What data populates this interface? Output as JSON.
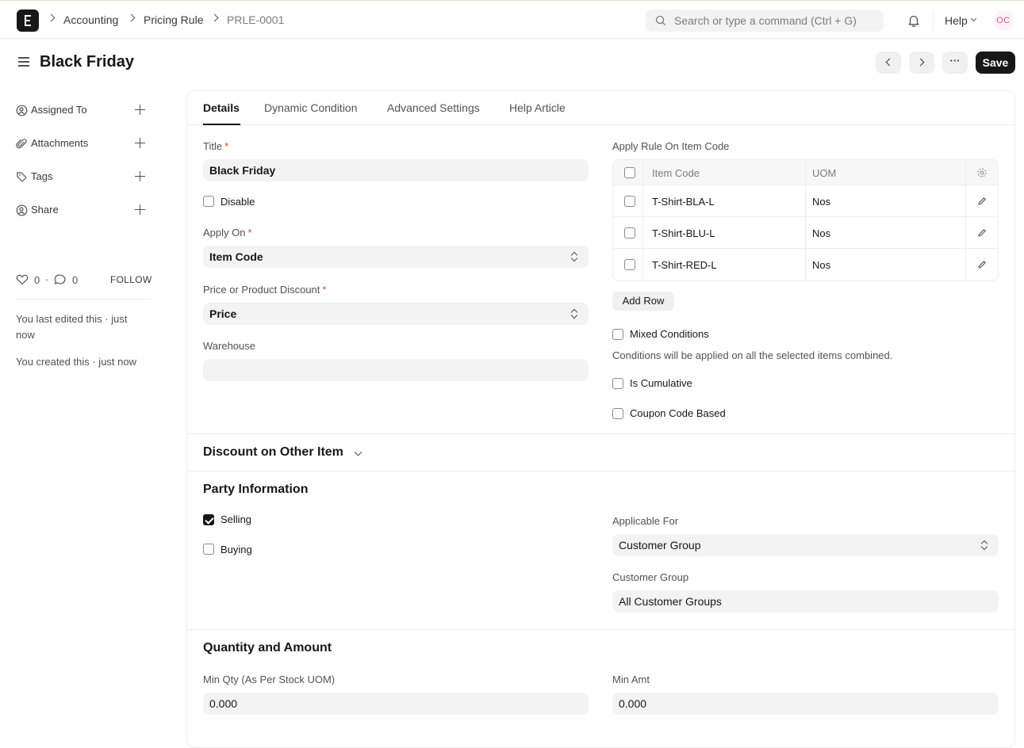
{
  "navbar": {
    "breadcrumbs": [
      "Accounting",
      "Pricing Rule",
      "PRLE-0001"
    ],
    "search_placeholder": "Search or type a command (Ctrl + G)",
    "help_label": "Help",
    "avatar_initials": "OC"
  },
  "page": {
    "title": "Black Friday",
    "save_label": "Save",
    "more_label": "···"
  },
  "sidebar": {
    "items": [
      {
        "label": "Assigned To",
        "icon": "user-add-icon"
      },
      {
        "label": "Attachments",
        "icon": "paperclip-icon"
      },
      {
        "label": "Tags",
        "icon": "tag-icon"
      },
      {
        "label": "Share",
        "icon": "share-user-icon"
      }
    ],
    "likes": "0",
    "comments": "0",
    "dot": "·",
    "follow_label": "FOLLOW",
    "last_edited": "You last edited this · just now",
    "created": "You created this · just now"
  },
  "tabs": [
    "Details",
    "Dynamic Condition",
    "Advanced Settings",
    "Help Article"
  ],
  "details": {
    "title_label": "Title",
    "title_value": "Black Friday",
    "disable_label": "Disable",
    "apply_on_label": "Apply On",
    "apply_on_value": "Item Code",
    "price_or_product_label": "Price or Product Discount",
    "price_or_product_value": "Price",
    "warehouse_label": "Warehouse",
    "warehouse_value": "",
    "required_mark": "*",
    "apply_rule_label": "Apply Rule On Item Code",
    "grid": {
      "columns": [
        "Item Code",
        "UOM"
      ],
      "rows": [
        {
          "item_code": "T-Shirt-BLA-L",
          "uom": "Nos"
        },
        {
          "item_code": "T-Shirt-BLU-L",
          "uom": "Nos"
        },
        {
          "item_code": "T-Shirt-RED-L",
          "uom": "Nos"
        }
      ],
      "add_row_label": "Add Row"
    },
    "mixed_conditions_label": "Mixed Conditions",
    "mixed_conditions_desc": "Conditions will be applied on all the selected items combined.",
    "is_cumulative_label": "Is Cumulative",
    "coupon_code_label": "Coupon Code Based"
  },
  "sections": {
    "discount_other": "Discount on Other Item",
    "party_info": "Party Information",
    "qty_amount": "Quantity and Amount"
  },
  "party": {
    "selling_label": "Selling",
    "selling_checked": true,
    "buying_label": "Buying",
    "buying_checked": false,
    "applicable_for_label": "Applicable For",
    "applicable_for_value": "Customer Group",
    "customer_group_label": "Customer Group",
    "customer_group_value": "All Customer Groups"
  },
  "qty": {
    "min_qty_label": "Min Qty (As Per Stock UOM)",
    "min_qty_value": "0.000",
    "min_amt_label": "Min Amt",
    "min_amt_value": "0.000"
  }
}
